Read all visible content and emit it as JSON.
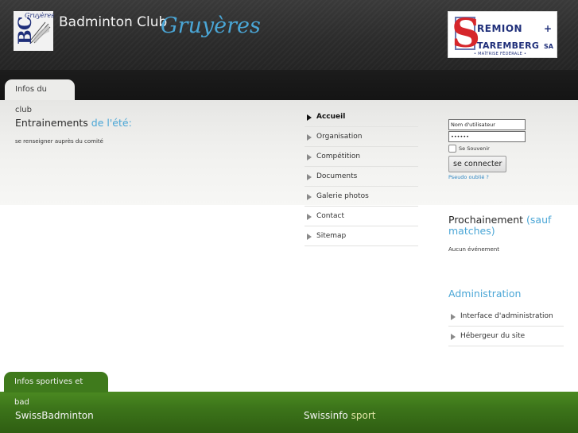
{
  "header": {
    "logo_letters": "BC",
    "logo_small_text": "Gruyères",
    "club_name": "Badminton Club",
    "club_city": "Gruyères",
    "sponsor": {
      "line1": "REMION",
      "line2": "TAREMBERG",
      "plus": "+",
      "suffix": "SA",
      "tagline": "• MAÎTRISE FÉDÉRALE •"
    }
  },
  "tabs": {
    "club": "Infos du club",
    "sport": "Infos sportives et bad"
  },
  "training": {
    "title": "Entrainements",
    "title_highlight": "de l'été:",
    "text": "se renseigner auprès du comité"
  },
  "menu": {
    "items": [
      {
        "label": "Accueil",
        "active": true
      },
      {
        "label": "Organisation",
        "active": false
      },
      {
        "label": "Compétition",
        "active": false
      },
      {
        "label": "Documents",
        "active": false
      },
      {
        "label": "Galerie photos",
        "active": false
      },
      {
        "label": "Contact",
        "active": false
      },
      {
        "label": "Sitemap",
        "active": false
      }
    ]
  },
  "login": {
    "username_value": "Nom d'utilisateur",
    "password_value": "••••••",
    "remember_label": "Se Souvenir",
    "submit_label": "se connecter",
    "forgot_label": "Pseudo oublié ?"
  },
  "events": {
    "title": "Prochainement",
    "title_highlight": "(sauf matches)",
    "empty": "Aucun événement"
  },
  "admin": {
    "title": "Administration",
    "items": [
      "Interface d'administration",
      "Hébergeur du site"
    ]
  },
  "footer": {
    "left_title": "SwissBadminton",
    "right_title": "Swissinfo",
    "right_highlight": "sport"
  },
  "colors": {
    "accent_blue": "#4aa6d6",
    "footer_green": "#3f7a1c",
    "header_dark": "#2b2b2b"
  }
}
